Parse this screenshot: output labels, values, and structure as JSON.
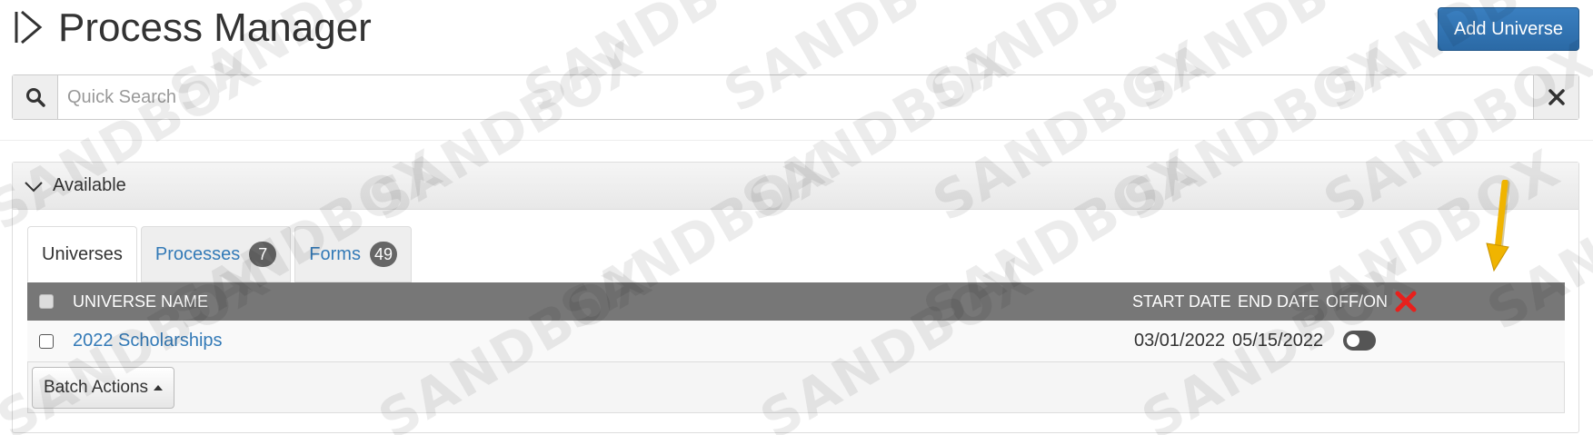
{
  "header": {
    "title": "Process Manager",
    "add_button_label": "Add Universe"
  },
  "search": {
    "placeholder": "Quick Search"
  },
  "panel": {
    "title": "Available"
  },
  "tabs": [
    {
      "label": "Universes",
      "badge": null,
      "active": true
    },
    {
      "label": "Processes",
      "badge": "7",
      "active": false
    },
    {
      "label": "Forms",
      "badge": "49",
      "active": false
    }
  ],
  "table": {
    "columns": {
      "name": "UNIVERSE NAME",
      "start": "START DATE",
      "end": "END DATE",
      "onoff": "OFF/ON"
    },
    "rows": [
      {
        "name": "2022 Scholarships",
        "start_date": "03/01/2022",
        "end_date": "05/15/2022",
        "enabled": false
      }
    ]
  },
  "batch": {
    "label": "Batch Actions"
  },
  "watermark": "SANDBOX",
  "colors": {
    "accent": "#337ab7",
    "primary_button": "#2b6aa6",
    "table_header": "#777777",
    "delete_red": "#e8201c",
    "annotation_arrow": "#f0b400"
  },
  "icons": {
    "title": "play-step-icon",
    "search": "search-icon",
    "clear": "close-icon",
    "collapse": "chevron-down-icon",
    "delete": "delete-x-icon"
  }
}
